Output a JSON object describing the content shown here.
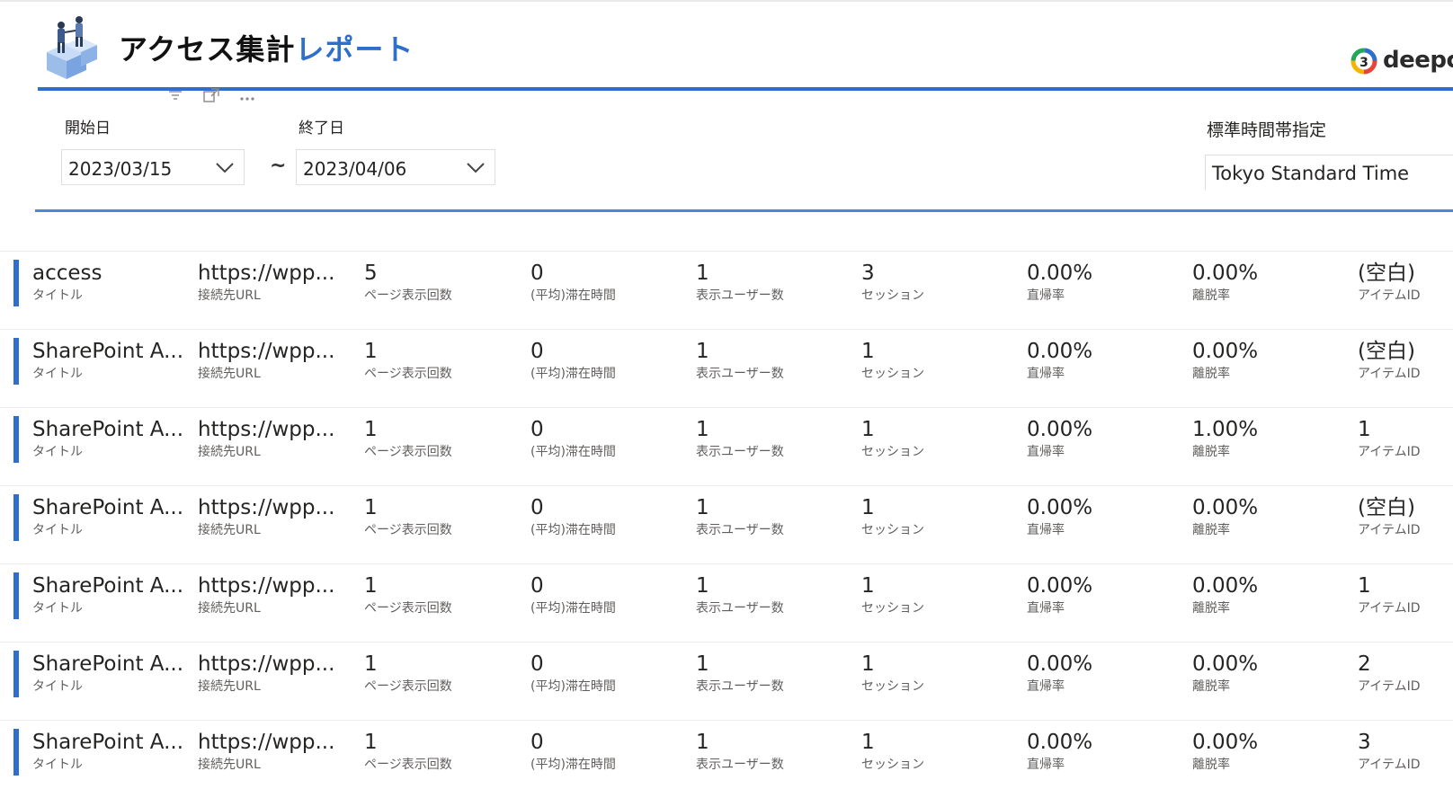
{
  "report": {
    "title_main": "アクセス集計",
    "title_accent": "レポート",
    "brand": "deepco"
  },
  "filters": {
    "start_label": "開始日",
    "start_value": "2023/03/15",
    "end_label": "終了日",
    "end_value": "2023/04/06",
    "separator": "~",
    "tz_label": "標準時間帯指定",
    "tz_value": "Tokyo Standard Time"
  },
  "colors": {
    "accent": "#2e6fcb",
    "rule": "#4f86d9"
  },
  "labels": {
    "title": "タイトル",
    "url": "接続先URL",
    "pageviews": "ページ表示回数",
    "avgtime": "(平均)滞在時間",
    "users": "表示ユーザー数",
    "sessions": "セッション",
    "bounce": "直帰率",
    "exit": "離脱率",
    "itemid": "アイテムID"
  },
  "rows": [
    {
      "title": "access",
      "url": "https://wpp...",
      "pageviews": "5",
      "avgtime": "0",
      "users": "1",
      "sessions": "3",
      "bounce": "0.00%",
      "exit": "0.00%",
      "itemid": "(空白)"
    },
    {
      "title": "SharePoint A...",
      "url": "https://wpp...",
      "pageviews": "1",
      "avgtime": "0",
      "users": "1",
      "sessions": "1",
      "bounce": "0.00%",
      "exit": "0.00%",
      "itemid": "(空白)"
    },
    {
      "title": "SharePoint A...",
      "url": "https://wpp...",
      "pageviews": "1",
      "avgtime": "0",
      "users": "1",
      "sessions": "1",
      "bounce": "0.00%",
      "exit": "1.00%",
      "itemid": "1"
    },
    {
      "title": "SharePoint A...",
      "url": "https://wpp...",
      "pageviews": "1",
      "avgtime": "0",
      "users": "1",
      "sessions": "1",
      "bounce": "0.00%",
      "exit": "0.00%",
      "itemid": "(空白)"
    },
    {
      "title": "SharePoint A...",
      "url": "https://wpp...",
      "pageviews": "1",
      "avgtime": "0",
      "users": "1",
      "sessions": "1",
      "bounce": "0.00%",
      "exit": "0.00%",
      "itemid": "1"
    },
    {
      "title": "SharePoint A...",
      "url": "https://wpp...",
      "pageviews": "1",
      "avgtime": "0",
      "users": "1",
      "sessions": "1",
      "bounce": "0.00%",
      "exit": "0.00%",
      "itemid": "2"
    },
    {
      "title": "SharePoint A...",
      "url": "https://wpp...",
      "pageviews": "1",
      "avgtime": "0",
      "users": "1",
      "sessions": "1",
      "bounce": "0.00%",
      "exit": "0.00%",
      "itemid": "3"
    }
  ]
}
